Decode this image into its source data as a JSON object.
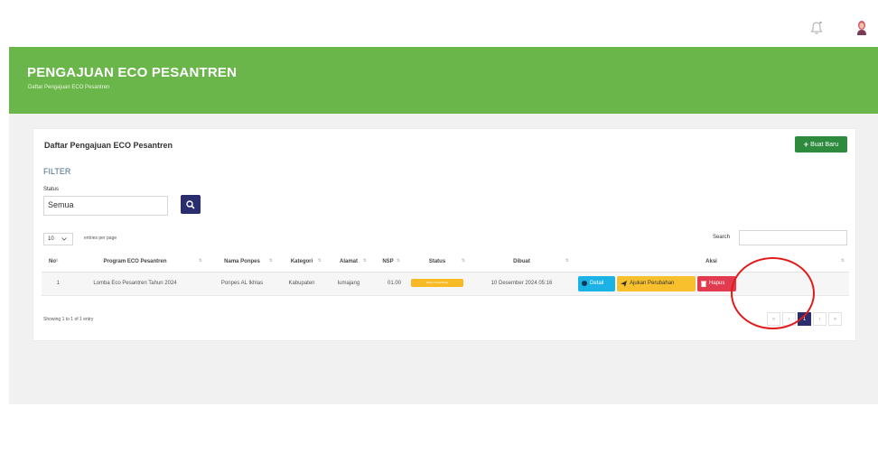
{
  "header": {
    "bell_icon": "bell-icon",
    "avatar": "user-avatar"
  },
  "banner": {
    "title": "PENGAJUAN ECO PESANTREN",
    "subtitle": "Daftar Pengajuan ECO Pesantren"
  },
  "card": {
    "title": "Daftar Pengajuan ECO Pesantren",
    "new_button": "Buat Baru",
    "filter_label": "FILTER",
    "status_label": "Status",
    "status_value": "Semua",
    "entries_value": "10",
    "entries_text": "entries per page",
    "search_label": "Search",
    "search_value": ""
  },
  "table": {
    "columns": [
      "No",
      "Program ECO Pesantren",
      "Nama Ponpes",
      "Kategori",
      "Alamat",
      "NSP",
      "Status",
      "Dibuat",
      "Aksi"
    ],
    "rows": [
      {
        "no": "1",
        "program": "Lomba Eco Pesantren Tahun 2024",
        "ponpes": "Ponpes AL Ikhlas",
        "kategori": "Kabupaten",
        "alamat": "lumajang",
        "nsp": "01.00",
        "status": "Belum Diverifikasi",
        "dibuat": "10 Desember 2024 05:16",
        "actions": {
          "detail": "Detail",
          "ajukan": "Ajukan Perubahan",
          "hapus": "Hapus"
        }
      }
    ]
  },
  "footer": {
    "showing": "Showing 1 to 1 of 1 entry",
    "pages": [
      "«",
      "‹",
      "1",
      "›",
      "»"
    ],
    "active_page": "1"
  },
  "colors": {
    "banner": "#6ab64a",
    "primary_dark": "#2b2e6e",
    "new_button": "#2e8b3e",
    "detail": "#1bb3e6",
    "ajukan": "#f7c02c",
    "hapus": "#e23a4e",
    "annotation": "#e21a1a"
  }
}
